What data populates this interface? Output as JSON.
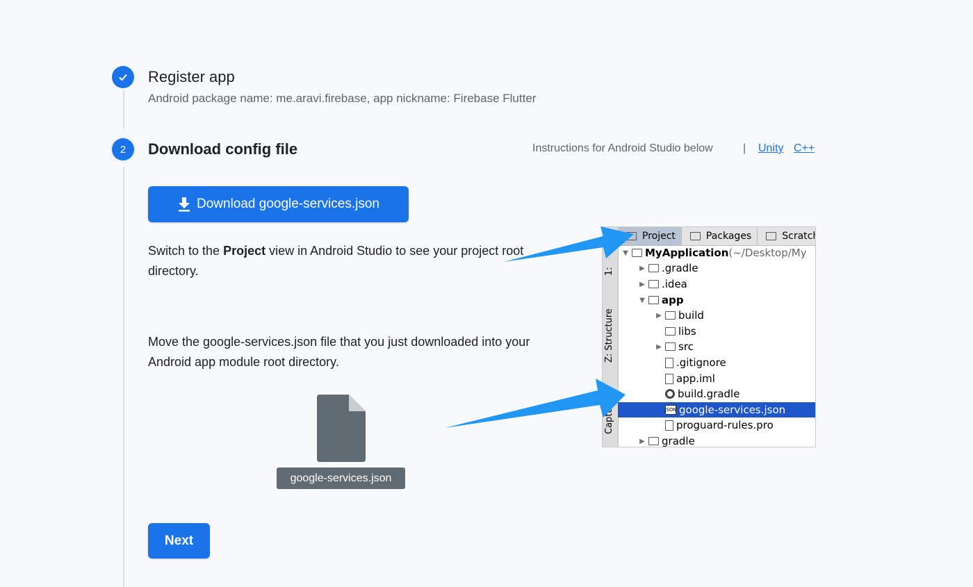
{
  "step1": {
    "title": "Register app",
    "subtitle": "Android package name: me.aravi.firebase, app nickname: Firebase Flutter"
  },
  "step2": {
    "number": "2",
    "title": "Download config file",
    "instructions": "Instructions for Android Studio below",
    "separator": "|",
    "links": [
      "Unity",
      "C++"
    ],
    "download_button": "Download google-services.json",
    "para1_prefix": "Switch to the ",
    "para1_bold": "Project",
    "para1_suffix": " view in Android Studio to see your project root directory.",
    "para2": "Move the google-services.json file that you just downloaded into your Android app module root directory.",
    "file_label": "google-services.json",
    "next_button": "Next"
  },
  "ide": {
    "tabs": [
      "Project",
      "Packages",
      "Scratches"
    ],
    "side_labels": [
      "1:",
      "Z: Structure",
      "Captures"
    ],
    "tree": [
      {
        "label": "MyApplication",
        "suffix": " (~/Desktop/My",
        "bold": true
      },
      {
        "label": ".gradle"
      },
      {
        "label": ".idea"
      },
      {
        "label": "app",
        "bold": true
      },
      {
        "label": "build"
      },
      {
        "label": "libs"
      },
      {
        "label": "src"
      },
      {
        "label": ".gitignore"
      },
      {
        "label": "app.iml"
      },
      {
        "label": "build.gradle"
      },
      {
        "label": "google-services.json",
        "selected": true
      },
      {
        "label": "proguard-rules.pro"
      },
      {
        "label": "gradle"
      }
    ]
  },
  "colors": {
    "primary": "#1a73e8",
    "selection": "#1e55c8",
    "arrow": "#2196f3",
    "file_icon": "#5f6a73"
  }
}
